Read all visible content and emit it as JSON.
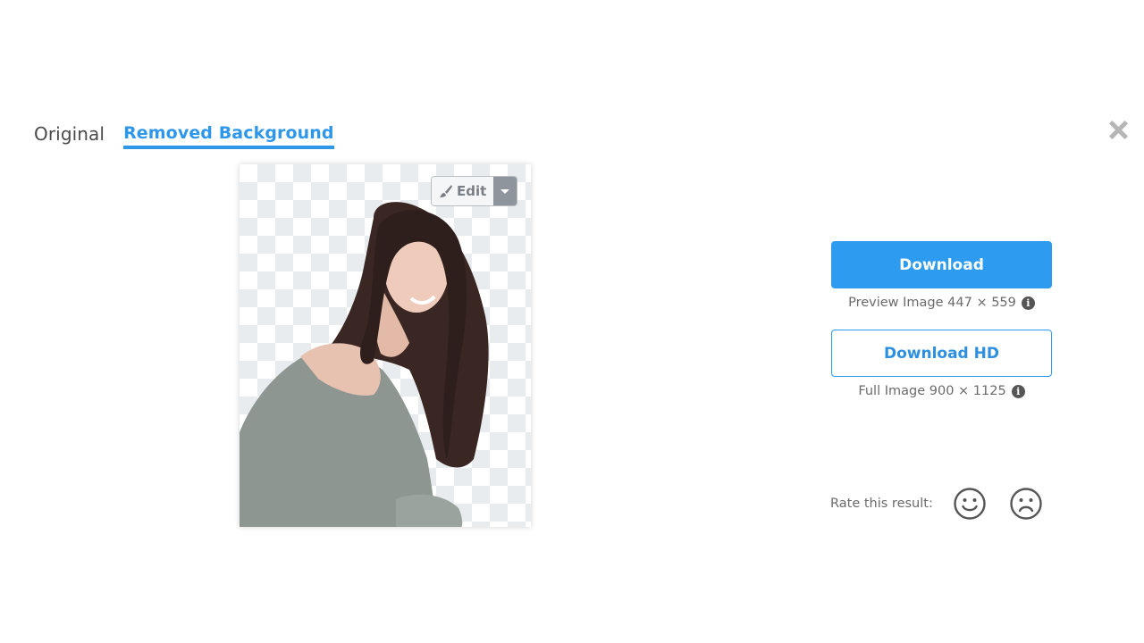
{
  "tabs": [
    {
      "label": "Original",
      "active": false
    },
    {
      "label": "Removed Background",
      "active": true
    }
  ],
  "image": {
    "alt": "Woman with long dark hair in grey off-shoulder sweater, background removed",
    "edit_label": "Edit"
  },
  "download": {
    "label": "Download",
    "meta": "Preview Image 447 × 559",
    "info_icon": "i"
  },
  "download_hd": {
    "label": "Download HD",
    "meta": "Full Image 900 × 1125",
    "info_icon": "i"
  },
  "rating": {
    "label": "Rate this result:",
    "options": [
      "smiley-happy",
      "smiley-sad"
    ]
  },
  "colors": {
    "accent": "#2d9bf0",
    "tab_active": "#2f97ea",
    "text_muted": "#6b6b6b"
  }
}
